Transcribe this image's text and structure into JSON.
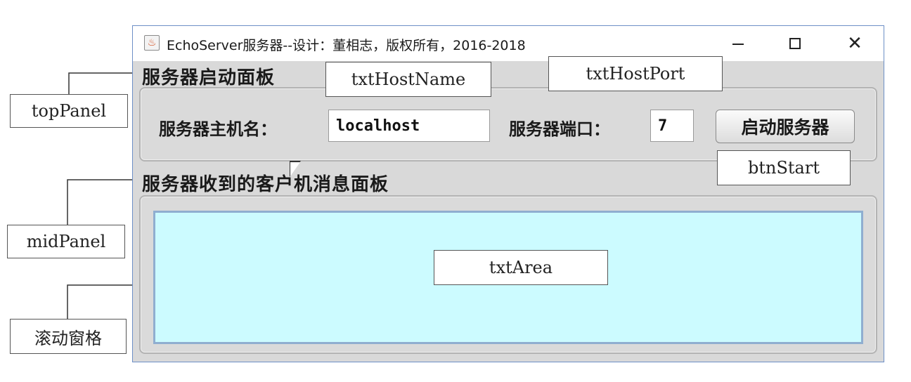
{
  "window": {
    "title": "EchoServer服务器--设计：董相志，版权所有，2016-2018",
    "icon": "java-cup-icon",
    "minimize_label": "—",
    "close_label": "✕"
  },
  "top_panel": {
    "title": "服务器启动面板",
    "host_label": "服务器主机名：",
    "host_value": "localhost",
    "port_label": "服务器端口：",
    "port_value": "7",
    "start_button": "启动服务器"
  },
  "mid_panel": {
    "title": "服务器收到的客户机消息面板",
    "text_area_value": "",
    "text_area_color": "#ccfbff"
  },
  "annotations": {
    "txt_host_name": "txtHostName",
    "txt_host_port": "txtHostPort",
    "btn_start": "btnStart",
    "txt_area": "txtArea",
    "top_panel": "topPanel",
    "mid_panel": "midPanel",
    "scroll_pane": "滚动窗格"
  }
}
